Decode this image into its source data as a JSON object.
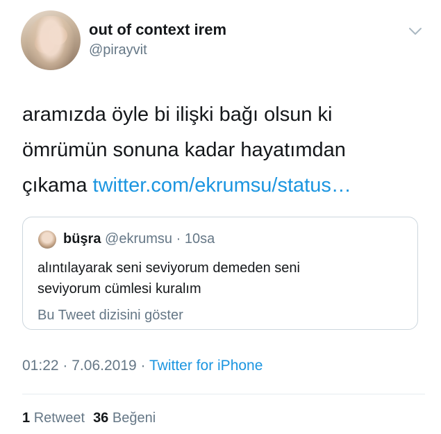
{
  "author": {
    "name": "out of context irem",
    "handle": "@pirayvit",
    "avatar_icon": "user-avatar"
  },
  "menu_icon": "chevron-down-icon",
  "tweet": {
    "text_line1": "aramızda öyle bi ilişki bağı olsun ki",
    "text_line2": "ömrümün sonuna kadar hayatımdan",
    "text_line3_prefix": "çıkama",
    "link": "twitter.com/ekrumsu/status…"
  },
  "quoted_tweet": {
    "name": "büşra",
    "handle": "@ekrumsu",
    "separator": "·",
    "time": "10sa",
    "text_line1": "alıntılayarak seni seviyorum demeden seni",
    "text_line2": "seviyorum cümlesi kuralım",
    "thread_link": "Bu Tweet dizisini göster"
  },
  "meta": {
    "time": "01:22",
    "dot1": "·",
    "date": "7.06.2019",
    "dot2": "·",
    "client": "Twitter for iPhone"
  },
  "stats": {
    "retweet_count": "1",
    "retweet_label": "Retweet",
    "like_count": "36",
    "like_label": "Beğeni"
  },
  "colors": {
    "link": "#1b95e0",
    "secondary_text": "#657786",
    "border": "#ccd6dd"
  }
}
